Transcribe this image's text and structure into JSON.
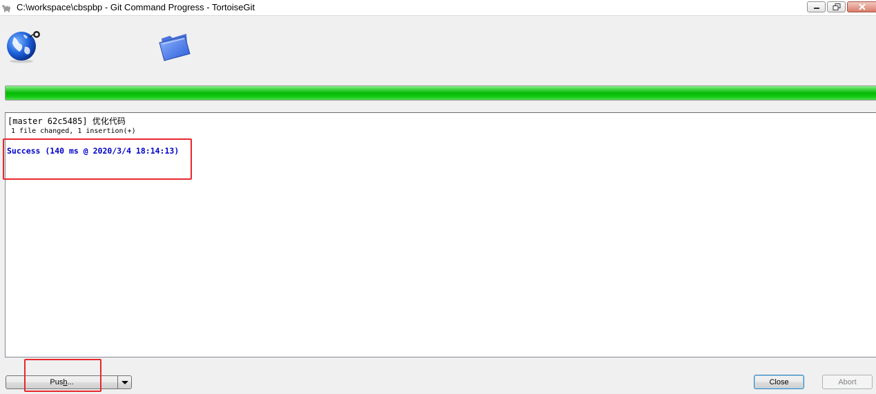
{
  "window": {
    "title": "C:\\workspace\\cbspbp - Git Command Progress - TortoiseGit",
    "controls": [
      "minimize-icon",
      "restore-icon",
      "close-icon"
    ]
  },
  "icons": {
    "app": "tortoise-icon",
    "remote": "globe-icon",
    "local": "folder-icon"
  },
  "progress": {
    "percent": 100,
    "color": "#07b807"
  },
  "log": {
    "commit_line": "[master 62c5485] 优化代码",
    "stats_line": " 1 file changed, 1 insertion(+)",
    "success_line": "Success (140 ms @ 2020/3/4 18:14:13)",
    "success_color": "#0000cc"
  },
  "buttons": {
    "push_label_before": "Pus",
    "push_label_accel": "h",
    "push_label_after": "...",
    "close_label": "Close",
    "abort_label": "Abort"
  },
  "annotation_color": "#e8262a"
}
